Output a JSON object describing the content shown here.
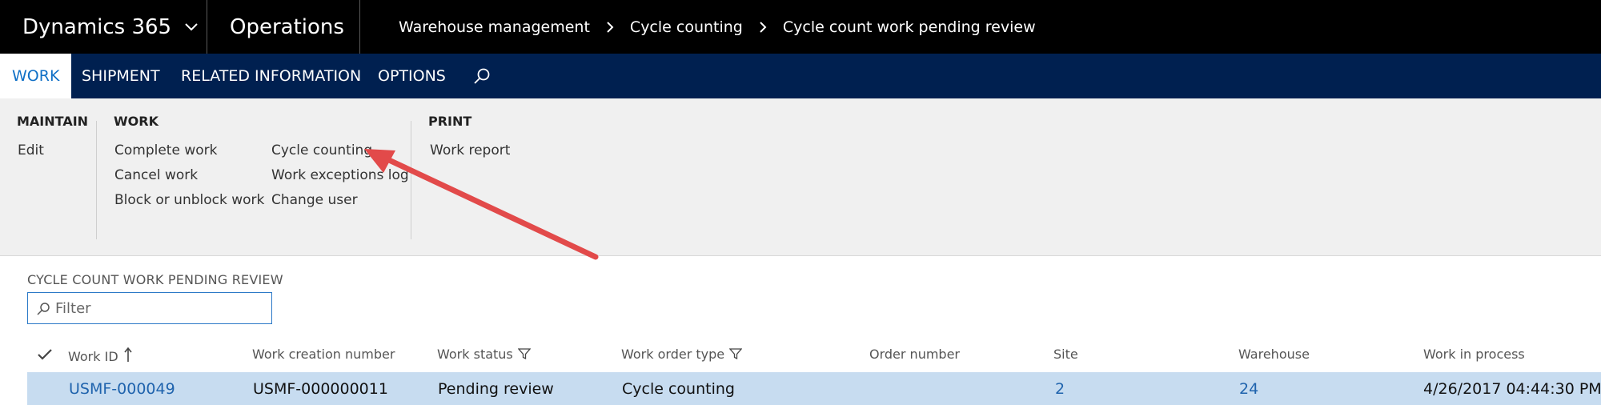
{
  "header": {
    "brand": "Dynamics 365",
    "module": "Operations",
    "breadcrumb": [
      "Warehouse management",
      "Cycle counting",
      "Cycle count work pending review"
    ]
  },
  "nav": {
    "tabs": [
      "WORK",
      "SHIPMENT",
      "RELATED INFORMATION",
      "OPTIONS"
    ],
    "active_tab": "WORK",
    "search_icon": "search-icon"
  },
  "ribbon": {
    "maintain": {
      "title": "MAINTAIN",
      "items": [
        "Edit"
      ]
    },
    "work": {
      "title": "WORK",
      "col1": [
        "Complete work",
        "Cancel work",
        "Block or unblock work"
      ],
      "col2": [
        "Cycle counting",
        "Work exceptions log",
        "Change user"
      ]
    },
    "print": {
      "title": "PRINT",
      "items": [
        "Work report"
      ]
    }
  },
  "content": {
    "section_title": "CYCLE COUNT WORK PENDING REVIEW",
    "filter_placeholder": "Filter",
    "columns": [
      "Work ID",
      "Work creation number",
      "Work status",
      "Work order type",
      "Order number",
      "Site",
      "Warehouse",
      "Work in process"
    ],
    "rows": [
      {
        "work_id": "USMF-000049",
        "work_creation_number": "USMF-000000011",
        "work_status": "Pending review",
        "work_order_type": "Cycle counting",
        "order_number": "",
        "site": "2",
        "warehouse": "24",
        "work_in_process": "4/26/2017 04:44:30 PM"
      }
    ]
  },
  "colors": {
    "topbar": "#000000",
    "navbar": "#002050",
    "active_tab_text": "#0f6fc6",
    "ribbon": "#f0f0f0",
    "selected_row": "#c7dcf0",
    "link": "#1f63ad",
    "annotation_arrow": "#e24a4a"
  }
}
